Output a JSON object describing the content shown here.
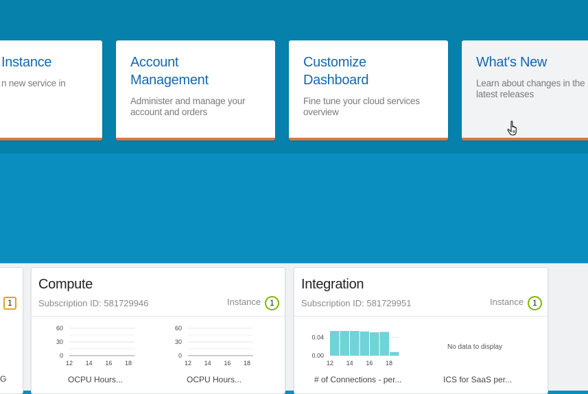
{
  "tiles": [
    {
      "title": "Instance",
      "desc": "n new service in"
    },
    {
      "title": "Account Management",
      "desc": "Administer and manage your account and orders"
    },
    {
      "title": "Customize Dashboard",
      "desc": "Fine tune your cloud services overview"
    },
    {
      "title": "What's New",
      "desc": "Learn about changes in the latest releases"
    }
  ],
  "partial_card": {
    "badge": "1",
    "caption_tail": "G"
  },
  "cards": [
    {
      "title": "Compute",
      "subscription": "Subscription ID: 581729946",
      "instance_label": "Instance",
      "badge": "1",
      "charts": [
        {
          "caption": "OCPU Hours..."
        },
        {
          "caption": "OCPU Hours..."
        }
      ]
    },
    {
      "title": "Integration",
      "subscription": "Subscription ID: 581729951",
      "instance_label": "Instance",
      "badge": "1",
      "charts": [
        {
          "caption": "# of Connections - per..."
        },
        {
          "caption": "ICS for SaaS per...",
          "empty_text": "No data to display"
        }
      ]
    }
  ],
  "chart_data": [
    {
      "type": "line",
      "y_ticks": [
        "60",
        "30",
        "0"
      ],
      "x_ticks": [
        "12",
        "14",
        "16",
        "18"
      ],
      "ylim": [
        0,
        60
      ],
      "series": []
    },
    {
      "type": "line",
      "y_ticks": [
        "60",
        "30",
        "0"
      ],
      "x_ticks": [
        "12",
        "14",
        "16",
        "18"
      ],
      "ylim": [
        0,
        60
      ],
      "series": []
    },
    {
      "type": "bar",
      "y_ticks": [
        "0.04",
        "0.00"
      ],
      "x_ticks": [
        "12",
        "14",
        "16",
        "18"
      ],
      "ylim": [
        0,
        0.06
      ],
      "values": [
        0.054,
        0.054,
        0.054,
        0.053,
        0.051,
        0.052,
        0.008
      ],
      "color": "#6fd3d8"
    }
  ],
  "colors": {
    "accent_orange": "#d87a3f",
    "tile_title_blue": "#1467b3",
    "badge_green": "#7ab800",
    "badge_amber": "#e3a21a",
    "bar_teal": "#6fd3d8"
  },
  "icons": {
    "cursor": "hand-pointer-icon"
  }
}
